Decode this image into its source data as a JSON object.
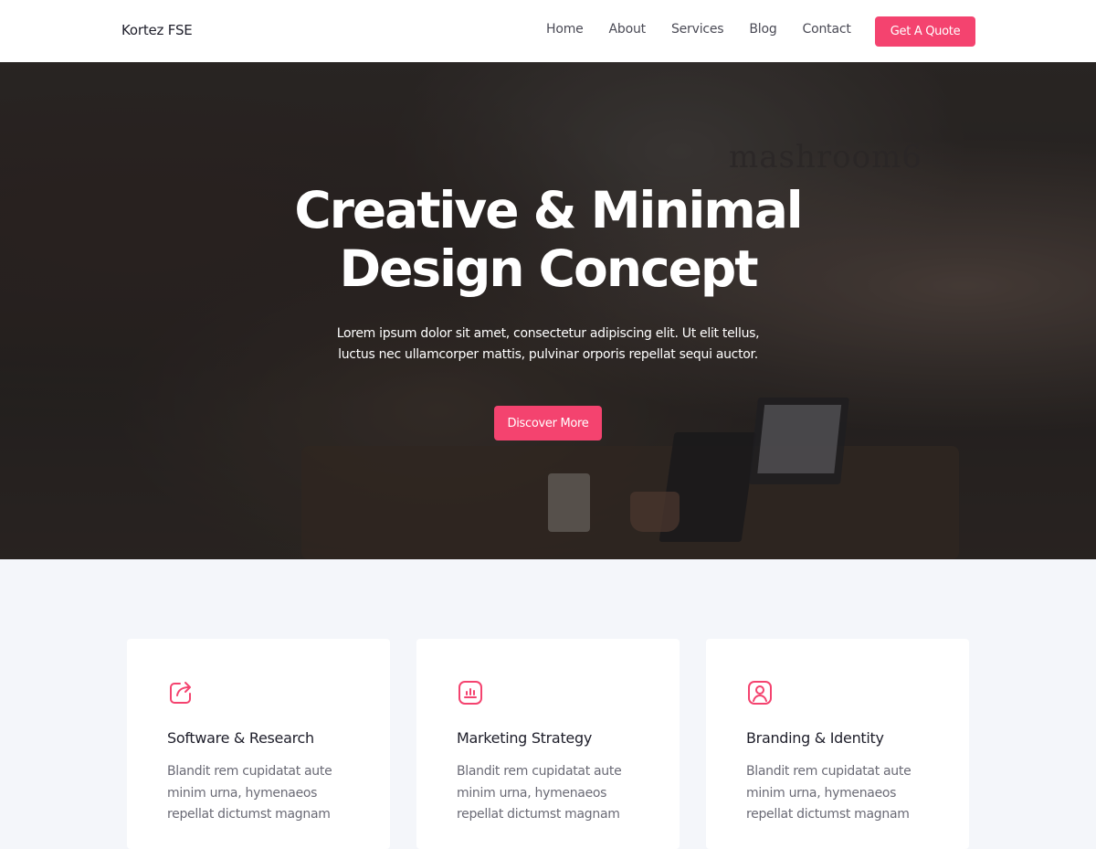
{
  "header": {
    "logo": "Kortez FSE",
    "nav": [
      "Home",
      "About",
      "Services",
      "Blog",
      "Contact"
    ],
    "cta_label": "Get A Quote"
  },
  "hero": {
    "title_line1": "Creative & Minimal",
    "title_line2": "Design Concept",
    "subtitle": "Lorem ipsum dolor sit amet, consectetur adipiscing elit. Ut elit tellus, luctus nec ullamcorper mattis, pulvinar orporis repellat sequi auctor.",
    "button_label": "Discover More",
    "background_text": "mashroom6"
  },
  "features": [
    {
      "icon": "share-icon",
      "title": "Software & Research",
      "text": "Blandit rem cupidatat aute minim urna, hymenaeos repellat dictumst magnam"
    },
    {
      "icon": "chart-icon",
      "title": "Marketing Strategy",
      "text": "Blandit rem cupidatat aute minim urna, hymenaeos repellat dictumst magnam"
    },
    {
      "icon": "user-icon",
      "title": "Branding & Identity",
      "text": "Blandit rem cupidatat aute minim urna, hymenaeos repellat dictumst magnam"
    }
  ],
  "colors": {
    "accent": "#f4436f",
    "background": "#f4f6fa",
    "card": "#ffffff",
    "text": "#1e1e2a",
    "muted": "#6a6a75"
  }
}
